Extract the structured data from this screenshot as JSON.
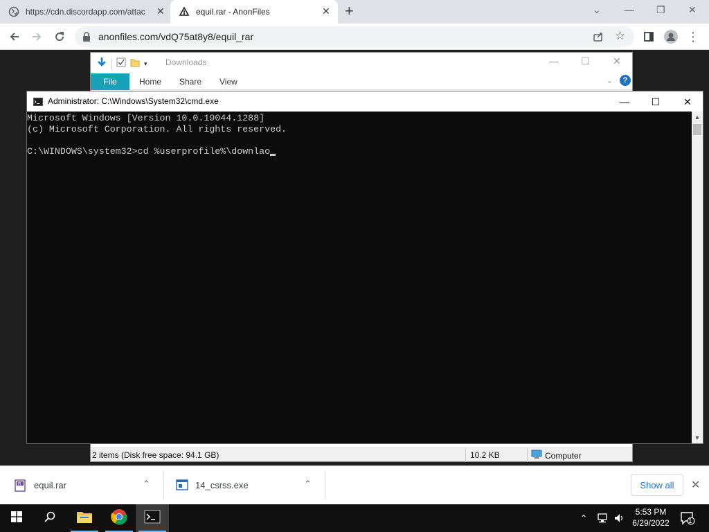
{
  "browser": {
    "tabs": [
      {
        "title": "https://cdn.discordapp.com/attac",
        "active": false,
        "favicon": "globe-icon"
      },
      {
        "title": "equil.rar - AnonFiles",
        "active": true,
        "favicon": "anonfiles-icon"
      }
    ],
    "url": "anonfiles.com/vdQ75at8y8/equil_rar"
  },
  "explorer": {
    "title": "Downloads",
    "ribbon_tabs": {
      "file": "File",
      "home": "Home",
      "share": "Share",
      "view": "View"
    },
    "help": "?",
    "status_items": "2 items (Disk free space: 94.1 GB)",
    "status_size": "10.2 KB",
    "status_location": "Computer"
  },
  "cmd": {
    "title": "Administrator: C:\\Windows\\System32\\cmd.exe",
    "lines": [
      "Microsoft Windows [Version 10.0.19044.1288]",
      "(c) Microsoft Corporation. All rights reserved.",
      "",
      "C:\\WINDOWS\\system32>cd %userprofile%\\downlao"
    ]
  },
  "downloads": {
    "items": [
      {
        "name": "equil.rar",
        "icon": "winrar-icon"
      },
      {
        "name": "14_csrss.exe",
        "icon": "exe-icon"
      }
    ],
    "show_all": "Show all"
  },
  "taskbar": {
    "time": "5:53 PM",
    "date": "6/29/2022",
    "notifications": "1"
  },
  "colors": {
    "accent": "#1a73e8",
    "explorer_file_tab": "#18a2b8",
    "console_bg": "#0c0c0c",
    "console_text": "#cccccc"
  }
}
